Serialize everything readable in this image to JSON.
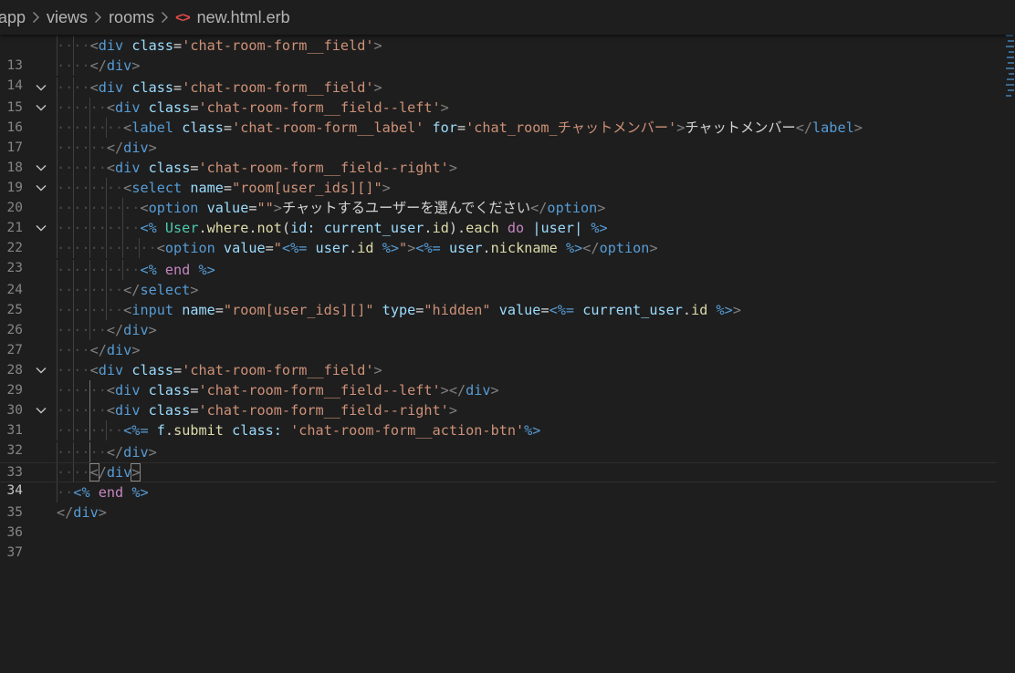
{
  "breadcrumb": {
    "items": [
      "app",
      "views",
      "rooms"
    ],
    "file": "new.html.erb"
  },
  "editor": {
    "current_line": 34,
    "lines": [
      {
        "n": "13",
        "fold": false
      },
      {
        "n": "14",
        "fold": false
      },
      {
        "n": "15",
        "fold": true
      },
      {
        "n": "16",
        "fold": true
      },
      {
        "n": "17",
        "fold": false
      },
      {
        "n": "18",
        "fold": false
      },
      {
        "n": "19",
        "fold": true
      },
      {
        "n": "20",
        "fold": true
      },
      {
        "n": "21",
        "fold": false
      },
      {
        "n": "22",
        "fold": true
      },
      {
        "n": "23",
        "fold": false
      },
      {
        "n": "24",
        "fold": false
      },
      {
        "n": "25",
        "fold": false
      },
      {
        "n": "26",
        "fold": false
      },
      {
        "n": "27",
        "fold": false
      },
      {
        "n": "28",
        "fold": false
      },
      {
        "n": "29",
        "fold": true
      },
      {
        "n": "30",
        "fold": false
      },
      {
        "n": "31",
        "fold": true
      },
      {
        "n": "32",
        "fold": false
      },
      {
        "n": "33",
        "fold": false
      },
      {
        "n": "34",
        "fold": false
      },
      {
        "n": "35",
        "fold": false
      },
      {
        "n": "36",
        "fold": false
      },
      {
        "n": "37",
        "fold": false
      }
    ],
    "code": {
      "l13": {
        "tag": "div",
        "attr": "class",
        "val": "'chat-room-form__field'"
      },
      "l14": {
        "tag": "div"
      },
      "l15": {
        "tag": "div",
        "attr": "class",
        "val": "'chat-room-form__field'"
      },
      "l16": {
        "tag": "div",
        "attr": "class",
        "val": "'chat-room-form__field--left'"
      },
      "l17": {
        "tag": "label",
        "attr1": "class",
        "val1": "'chat-room-form__label'",
        "attr2": "for",
        "val2": "'chat_room_チャットメンバー'",
        "text": "チャットメンバー"
      },
      "l18": {
        "tag": "div"
      },
      "l19": {
        "tag": "div",
        "attr": "class",
        "val": "'chat-room-form__field--right'"
      },
      "l20": {
        "tag": "select",
        "attr": "name",
        "val": "\"room[user_ids][]\""
      },
      "l21": {
        "tag": "option",
        "attr": "value",
        "val": "\"\"",
        "text": "チャットするユーザーを選んでください"
      },
      "l22": {
        "open": "<%",
        "cls": "User",
        "m1": "where",
        "m2": "not",
        "key": "id:",
        "obj": "current_user",
        "m3": "id",
        "m4": "each",
        "kw": "do",
        "blk": "|user|",
        "close": "%>"
      },
      "l23": {
        "tag": "option",
        "attr": "value",
        "q": "\"",
        "open": "<%=",
        "obj": "user",
        "m": "id",
        "close": "%>",
        "obj2": "user",
        "m2": "nickname"
      },
      "l24": {
        "open": "<%",
        "kw": "end",
        "close": "%>"
      },
      "l25": {
        "tag": "select"
      },
      "l26": {
        "tag": "input",
        "a1": "name",
        "v1": "\"room[user_ids][]\"",
        "a2": "type",
        "v2": "\"hidden\"",
        "a3": "value",
        "open": "<%=",
        "obj": "current_user",
        "m": "id",
        "close": "%>"
      },
      "l27": {
        "tag": "div"
      },
      "l28": {
        "tag": "div"
      },
      "l29": {
        "tag": "div",
        "attr": "class",
        "val": "'chat-room-form__field'"
      },
      "l30": {
        "tag": "div",
        "attr": "class",
        "val": "'chat-room-form__field--left'"
      },
      "l31": {
        "tag": "div",
        "attr": "class",
        "val": "'chat-room-form__field--right'"
      },
      "l32": {
        "open": "<%=",
        "obj": "f",
        "m": "submit",
        "sym": "class:",
        "val": "'chat-room-form__action-btn'",
        "close": "%>"
      },
      "l33": {
        "tag": "div"
      },
      "l34": {
        "tag": "div"
      },
      "l35": {
        "open": "<%",
        "kw": "end",
        "close": "%>"
      },
      "l36": {
        "tag": "div"
      }
    }
  },
  "colors": {
    "background": "#1e1e1e",
    "tag": "#569cd6",
    "attribute": "#9cdcfe",
    "string": "#ce9178",
    "keyword": "#c586c0",
    "class": "#4ec9b0",
    "method": "#dcdcaa",
    "file_icon": "#e44b4b"
  }
}
